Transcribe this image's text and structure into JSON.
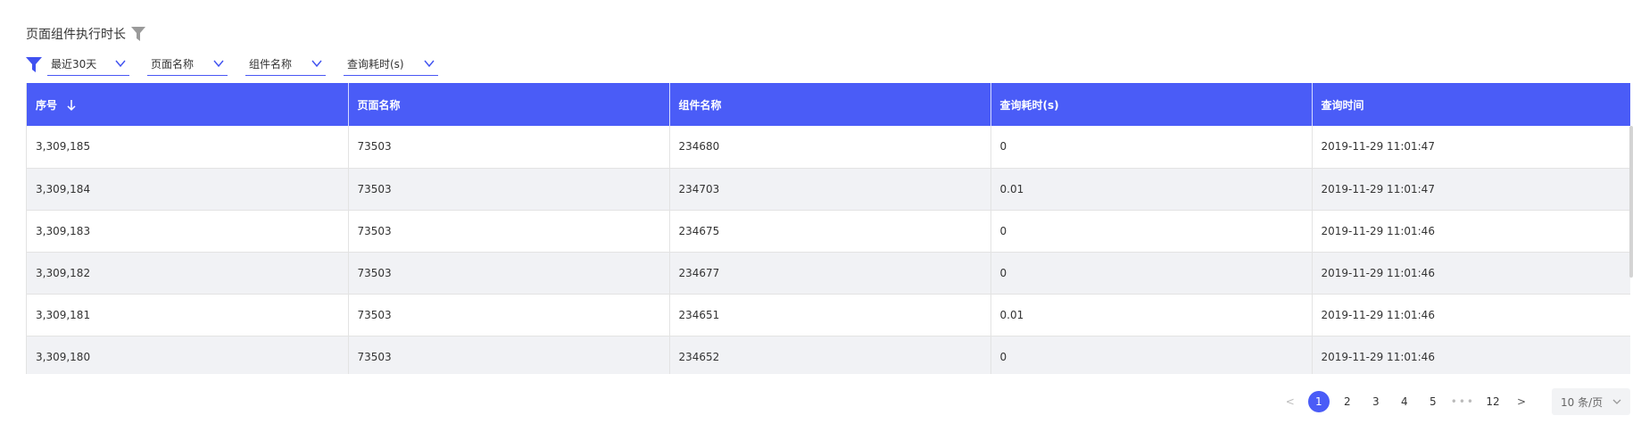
{
  "header": {
    "title": "页面组件执行时长"
  },
  "filters": {
    "range": "最近30天",
    "page_name": "页面名称",
    "component_name": "组件名称",
    "query_time": "查询耗时(s)"
  },
  "table": {
    "columns": [
      "序号",
      "页面名称",
      "组件名称",
      "查询耗时(s)",
      "查询时间"
    ],
    "rows": [
      [
        "3,309,185",
        "73503",
        "234680",
        "0",
        "2019-11-29 11:01:47"
      ],
      [
        "3,309,184",
        "73503",
        "234703",
        "0.01",
        "2019-11-29 11:01:47"
      ],
      [
        "3,309,183",
        "73503",
        "234675",
        "0",
        "2019-11-29 11:01:46"
      ],
      [
        "3,309,182",
        "73503",
        "234677",
        "0",
        "2019-11-29 11:01:46"
      ],
      [
        "3,309,181",
        "73503",
        "234651",
        "0.01",
        "2019-11-29 11:01:46"
      ],
      [
        "3,309,180",
        "73503",
        "234652",
        "0",
        "2019-11-29 11:01:46"
      ]
    ]
  },
  "pagination": {
    "prev": "<",
    "pages": [
      "1",
      "2",
      "3",
      "4",
      "5"
    ],
    "ellipsis": "•••",
    "last": "12",
    "next": ">",
    "current": 1,
    "page_size": "10 条/页"
  },
  "colors": {
    "accent": "#4a5cf7",
    "row_alt": "#f1f2f5"
  }
}
